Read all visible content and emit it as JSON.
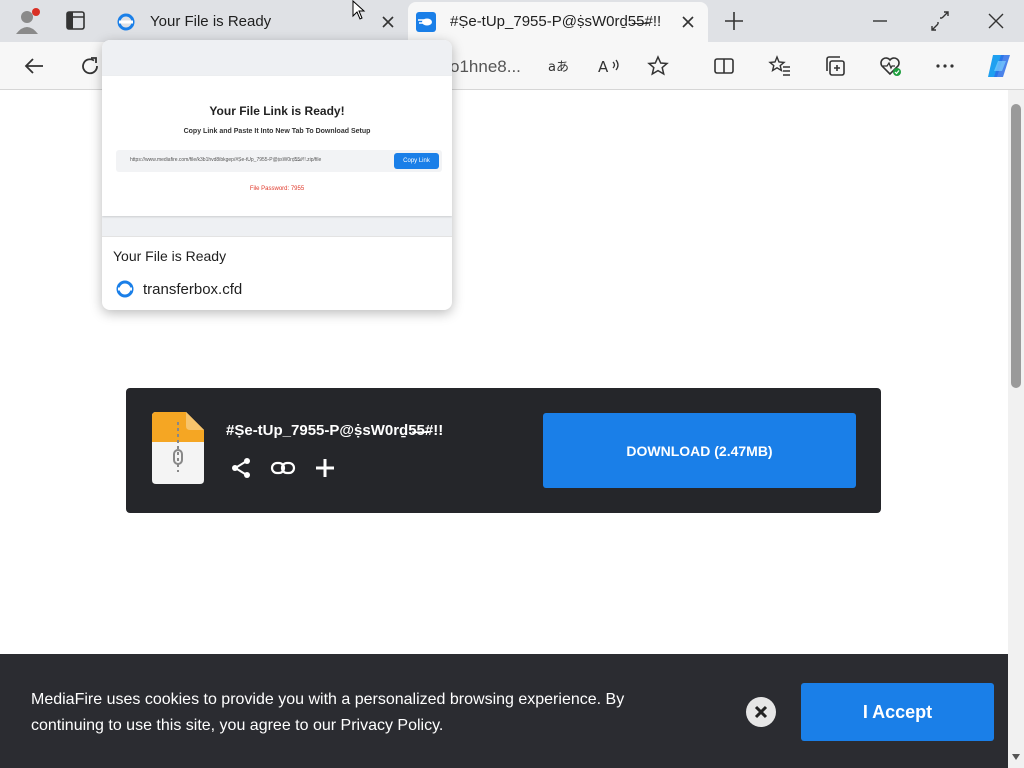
{
  "tabs": [
    {
      "title": "Your File is Ready",
      "favicon": "transfer-icon"
    },
    {
      "title": "#Ṣe-tUp_7955-P@ṩsW0rḏ5̶5̶#!!",
      "favicon": "mediafire-icon"
    }
  ],
  "address_bar": {
    "visible_text": "o1hne8..."
  },
  "hover_card": {
    "preview": {
      "heading": "Your File Link is Ready!",
      "subheading": "Copy Link and Paste It Into New Tab To Download Setup",
      "url": "https://www.mediafire.com/file/k3b1hvd8ibkgep/#Ṣe-tUp_7955-P@ṩsW0rḏ5̶5̶#!!.zip/file",
      "copy_button": "Copy Link",
      "password": "File Password: 7955"
    },
    "title": "Your File is Ready",
    "domain": "transferbox.cfd"
  },
  "download": {
    "filename": "#Ṣe-tUp_7955-P@ṩsW0rḏ5̶5̶#!!",
    "button": "DOWNLOAD (2.47MB)"
  },
  "cookie_banner": {
    "text": "MediaFire uses cookies to provide you with a personalized browsing experience. By continuing to use this site, you agree to our Privacy Policy.",
    "accept": "I Accept"
  },
  "colors": {
    "accent": "#1a7fe8",
    "dark_panel": "#25262a",
    "banner": "#2b2c31",
    "password_red": "#e0392b"
  }
}
